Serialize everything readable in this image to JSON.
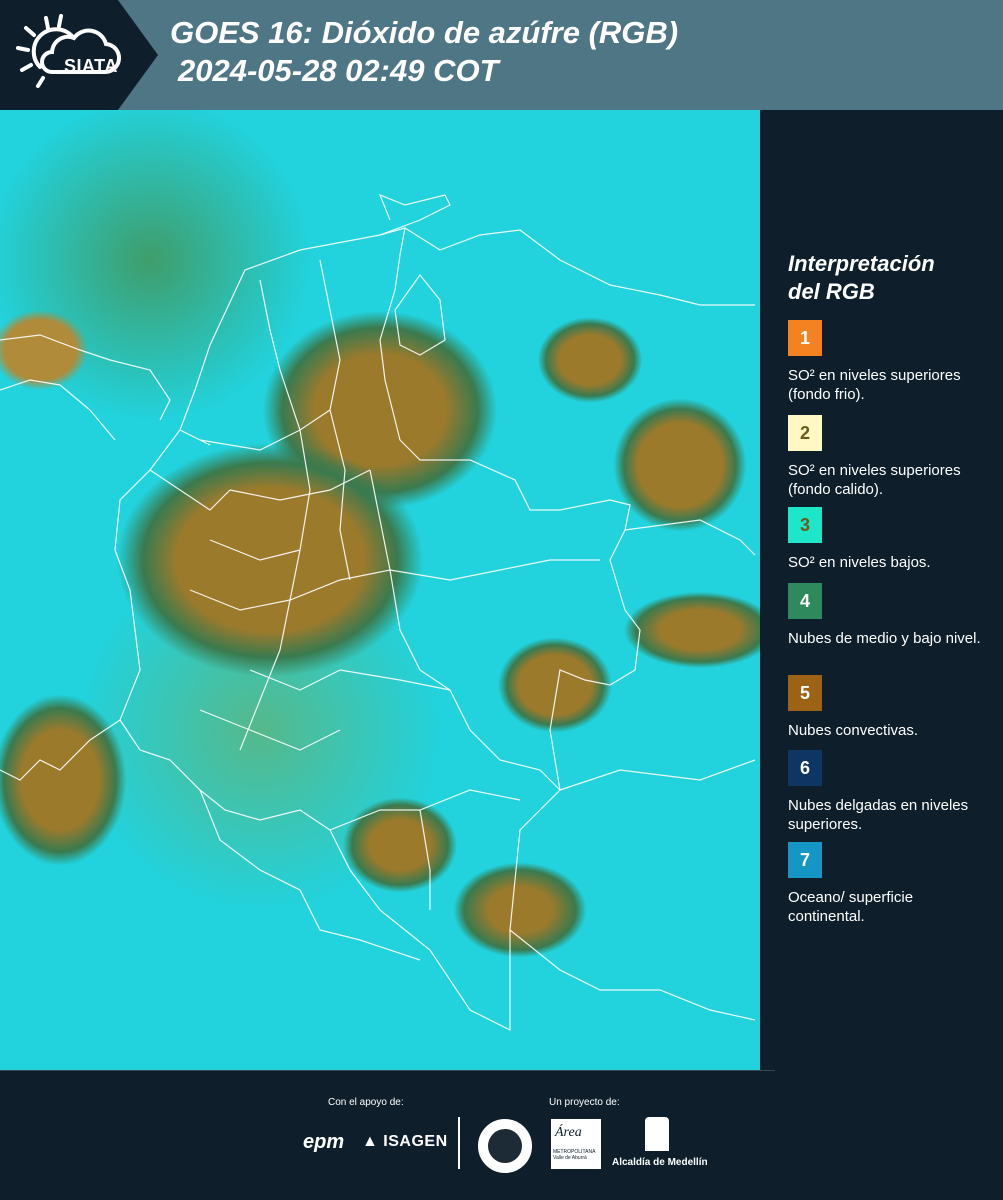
{
  "header": {
    "logo_text": "SIATA",
    "title_line1": "GOES 16: Dióxido de azúfre (RGB)",
    "title_line2": "2024-05-28 02:49 COT"
  },
  "legend": {
    "title_line1": "Interpretación",
    "title_line2": "del RGB",
    "items": [
      {
        "number": "1",
        "color": "#f58220",
        "label": "SO² en niveles superiores (fondo frio)."
      },
      {
        "number": "2",
        "color": "#fff8c4",
        "label": "SO² en niveles superiores (fondo calido)."
      },
      {
        "number": "3",
        "color": "#1ee6c8",
        "label": "SO² en niveles bajos."
      },
      {
        "number": "4",
        "color": "#2e8a5c",
        "label": "Nubes de medio y bajo nivel."
      },
      {
        "number": "5",
        "color": "#9c6316",
        "label": "Nubes convectivas."
      },
      {
        "number": "6",
        "color": "#0f3564",
        "label": "Nubes delgadas en niveles superiores."
      },
      {
        "number": "7",
        "color": "#1696c4",
        "label": "Oceano/ superficie continental."
      }
    ]
  },
  "footer": {
    "support_label": "Con el apoyo de:",
    "project_label": "Un proyecto de:",
    "sponsor1": "epm",
    "sponsor2": "ISAGEN",
    "partner_area": "Área",
    "partner_area_sub": "METROPOLITANA Valle de Aburrá",
    "partner_alcaldia": "Alcaldía de Medellín"
  },
  "map": {
    "product_colors": {
      "ocean_land": "#22d2dc",
      "low_mid_clouds": "#3f9d6b",
      "convective": "#9c7a2c"
    }
  }
}
